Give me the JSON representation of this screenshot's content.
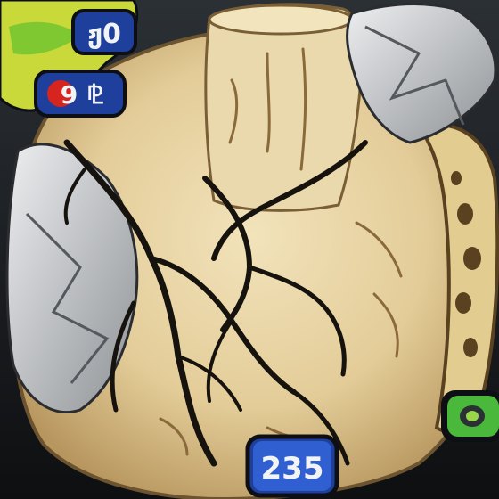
{
  "scene": {
    "description_hidden": "",
    "badges": [
      {
        "id": "top-left-upper",
        "text": "ჟ0",
        "fill": "#2a4fb8",
        "border": "#0d0f14"
      },
      {
        "id": "top-left-lower",
        "text": "9 ⅊",
        "fill": "#2a4fb8",
        "border": "#0d0f14"
      },
      {
        "id": "bottom-center",
        "text": "235",
        "fill": "#2f5fd0",
        "border": "#0d0f14"
      },
      {
        "id": "right-edge",
        "text": "",
        "fill": "#4ab83a",
        "border": "#0d0f14"
      }
    ],
    "colors": {
      "background": "#1b1d20",
      "stone": "#e6d3a6",
      "stone_dark": "#b89a68",
      "crack": "#16120d",
      "paper": "#d9dadb",
      "paper_shadow": "#8e9094",
      "green": "#7fc832",
      "yellow": "#d8e03a"
    }
  }
}
